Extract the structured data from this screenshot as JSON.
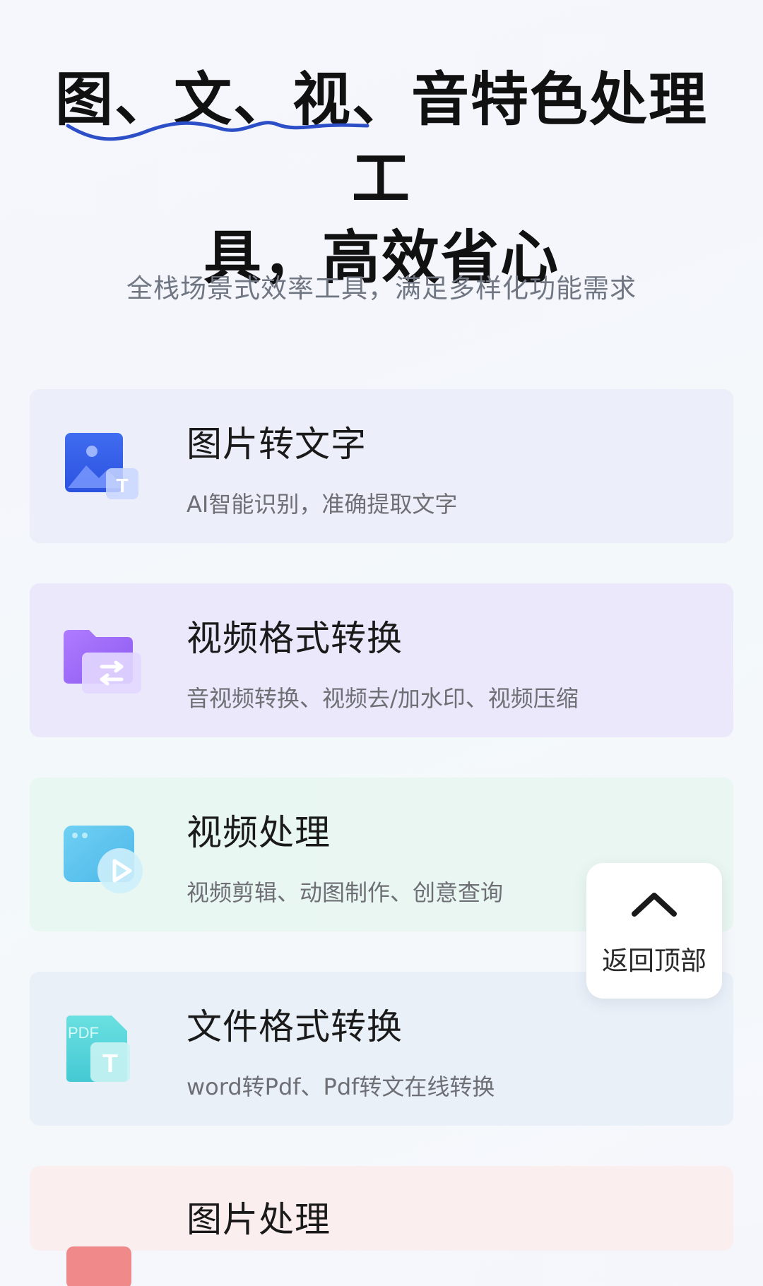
{
  "header": {
    "headline_line1": "图、文、视、音特色处理工",
    "headline_line2": "具，高效省心",
    "subtitle": "全栈场景式效率工具，满足多样化功能需求"
  },
  "features": [
    {
      "title": "图片转文字",
      "description": "AI智能识别，准确提取文字",
      "icon": "image-to-text-icon"
    },
    {
      "title": "视频格式转换",
      "description": "音视频转换、视频去/加水印、视频压缩",
      "icon": "folder-convert-icon"
    },
    {
      "title": "视频处理",
      "description": "视频剪辑、动图制作、创意查询",
      "icon": "video-play-icon"
    },
    {
      "title": "文件格式转换",
      "description": "word转Pdf、Pdf转文在线转换",
      "icon": "pdf-to-text-icon"
    },
    {
      "title": "图片处理",
      "icon": "image-edit-icon"
    }
  ],
  "back_to_top": {
    "label": "返回顶部",
    "icon": "chevron-up-icon"
  },
  "colors": {
    "accent_blue": "#2c4ec7",
    "card_1_bg": "#eceef9",
    "card_2_bg": "#ebe8fb",
    "card_3_bg": "#e9f7f3",
    "card_4_bg": "#e9f0f8",
    "card_5_bg": "#fbeeee"
  },
  "icon_text": {
    "t_letter": "T",
    "pdf_letters": "PDF"
  }
}
